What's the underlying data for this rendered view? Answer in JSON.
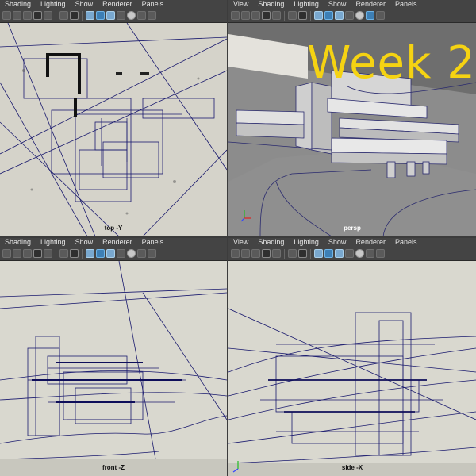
{
  "menu": {
    "items": [
      "Shading",
      "Lighting",
      "Show",
      "Renderer",
      "Panels"
    ],
    "items_with_view": [
      "View",
      "Shading",
      "Lighting",
      "Show",
      "Renderer",
      "Panels"
    ]
  },
  "viewports": {
    "top": {
      "label": "top -Y"
    },
    "persp": {
      "label": "persp"
    },
    "front": {
      "label": "front -Z"
    },
    "side": {
      "label": "side -X"
    }
  },
  "overlay": {
    "title": "Week 2",
    "color": "#f5d312"
  },
  "colors": {
    "wire": "#1a1a6e",
    "sheet": "#dcdbd2",
    "menubar": "#444444"
  }
}
